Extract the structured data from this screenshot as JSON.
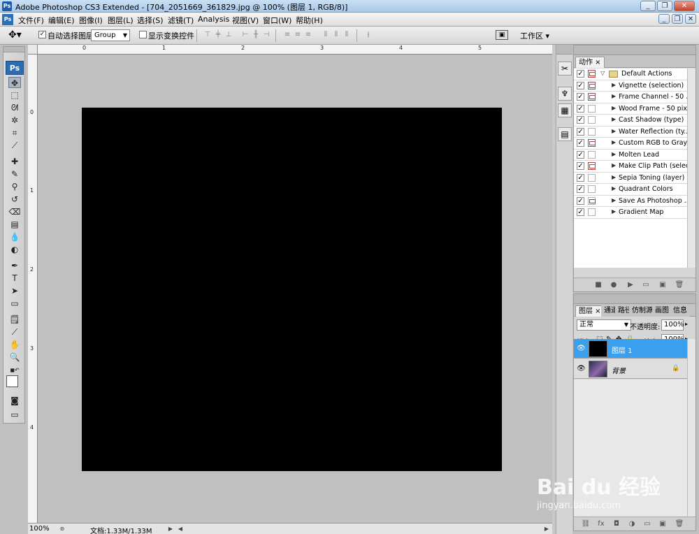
{
  "titlebar": {
    "icon": "Ps",
    "title": "Adobe Photoshop CS3 Extended - [704_2051669_361829.jpg @ 100% (图层 1, RGB/8)]",
    "minimize": "_",
    "restore": "❐",
    "close": "✕"
  },
  "menubar": {
    "icon": "Ps",
    "items": [
      "文件(F)",
      "编辑(E)",
      "图像(I)",
      "图层(L)",
      "选择(S)",
      "滤镜(T)",
      "Analysis",
      "视图(V)",
      "窗口(W)",
      "帮助(H)"
    ],
    "doc_minimize": "_",
    "doc_restore": "❐",
    "doc_close": "✕"
  },
  "options": {
    "auto_select_checked": true,
    "auto_select_label": "自动选择图层",
    "group_value": "Group",
    "show_transform_checked": false,
    "show_transform_label": "显示变换控件",
    "workspace_label": "工作区 ▾"
  },
  "rulers": {
    "horizontal": [
      "0",
      "1",
      "2",
      "3",
      "4",
      "5"
    ],
    "vertical": [
      "0",
      "1",
      "2",
      "3",
      "4"
    ]
  },
  "status": {
    "zoom": "100%",
    "doc_size": "文档:1.33M/1.33M"
  },
  "actions_panel": {
    "tab_label": "动作 ×",
    "set_name": "Default Actions",
    "items": [
      {
        "name": "Vignette (selection)",
        "dialog": "red"
      },
      {
        "name": "Frame Channel - 50 ...",
        "dialog": "red"
      },
      {
        "name": "Wood Frame - 50 pixel",
        "dialog": "none"
      },
      {
        "name": "Cast Shadow (type)",
        "dialog": "none"
      },
      {
        "name": "Water Reflection (ty...",
        "dialog": "none"
      },
      {
        "name": "Custom RGB to Gray...",
        "dialog": "red"
      },
      {
        "name": "Molten Lead",
        "dialog": "none"
      },
      {
        "name": "Make Clip Path (selec...",
        "dialog": "red"
      },
      {
        "name": "Sepia Toning (layer)",
        "dialog": "none"
      },
      {
        "name": "Quadrant Colors",
        "dialog": "none"
      },
      {
        "name": "Save As Photoshop ...",
        "dialog": "dark"
      },
      {
        "name": "Gradient Map",
        "dialog": "none"
      }
    ]
  },
  "layers_panel": {
    "tabs": [
      "图层 ×",
      "通道",
      "路径",
      "仿制源",
      "画图",
      "信息"
    ],
    "blend_mode": "正常",
    "opacity_label": "不透明度:",
    "opacity_value": "100%",
    "lock_label": "锁定:",
    "fill_label": "填充:",
    "fill_value": "100%",
    "layers": [
      {
        "name": "图层 1",
        "selected": true
      },
      {
        "name": "背景",
        "selected": false,
        "locked": true
      }
    ]
  },
  "watermark": {
    "brand": "Bai du 经验",
    "site": "jingyan.baidu.com"
  },
  "colors": {
    "canvas_bg": "#c0c0c0",
    "image_fill": "#000000",
    "selected_layer": "#3aa0ee"
  }
}
